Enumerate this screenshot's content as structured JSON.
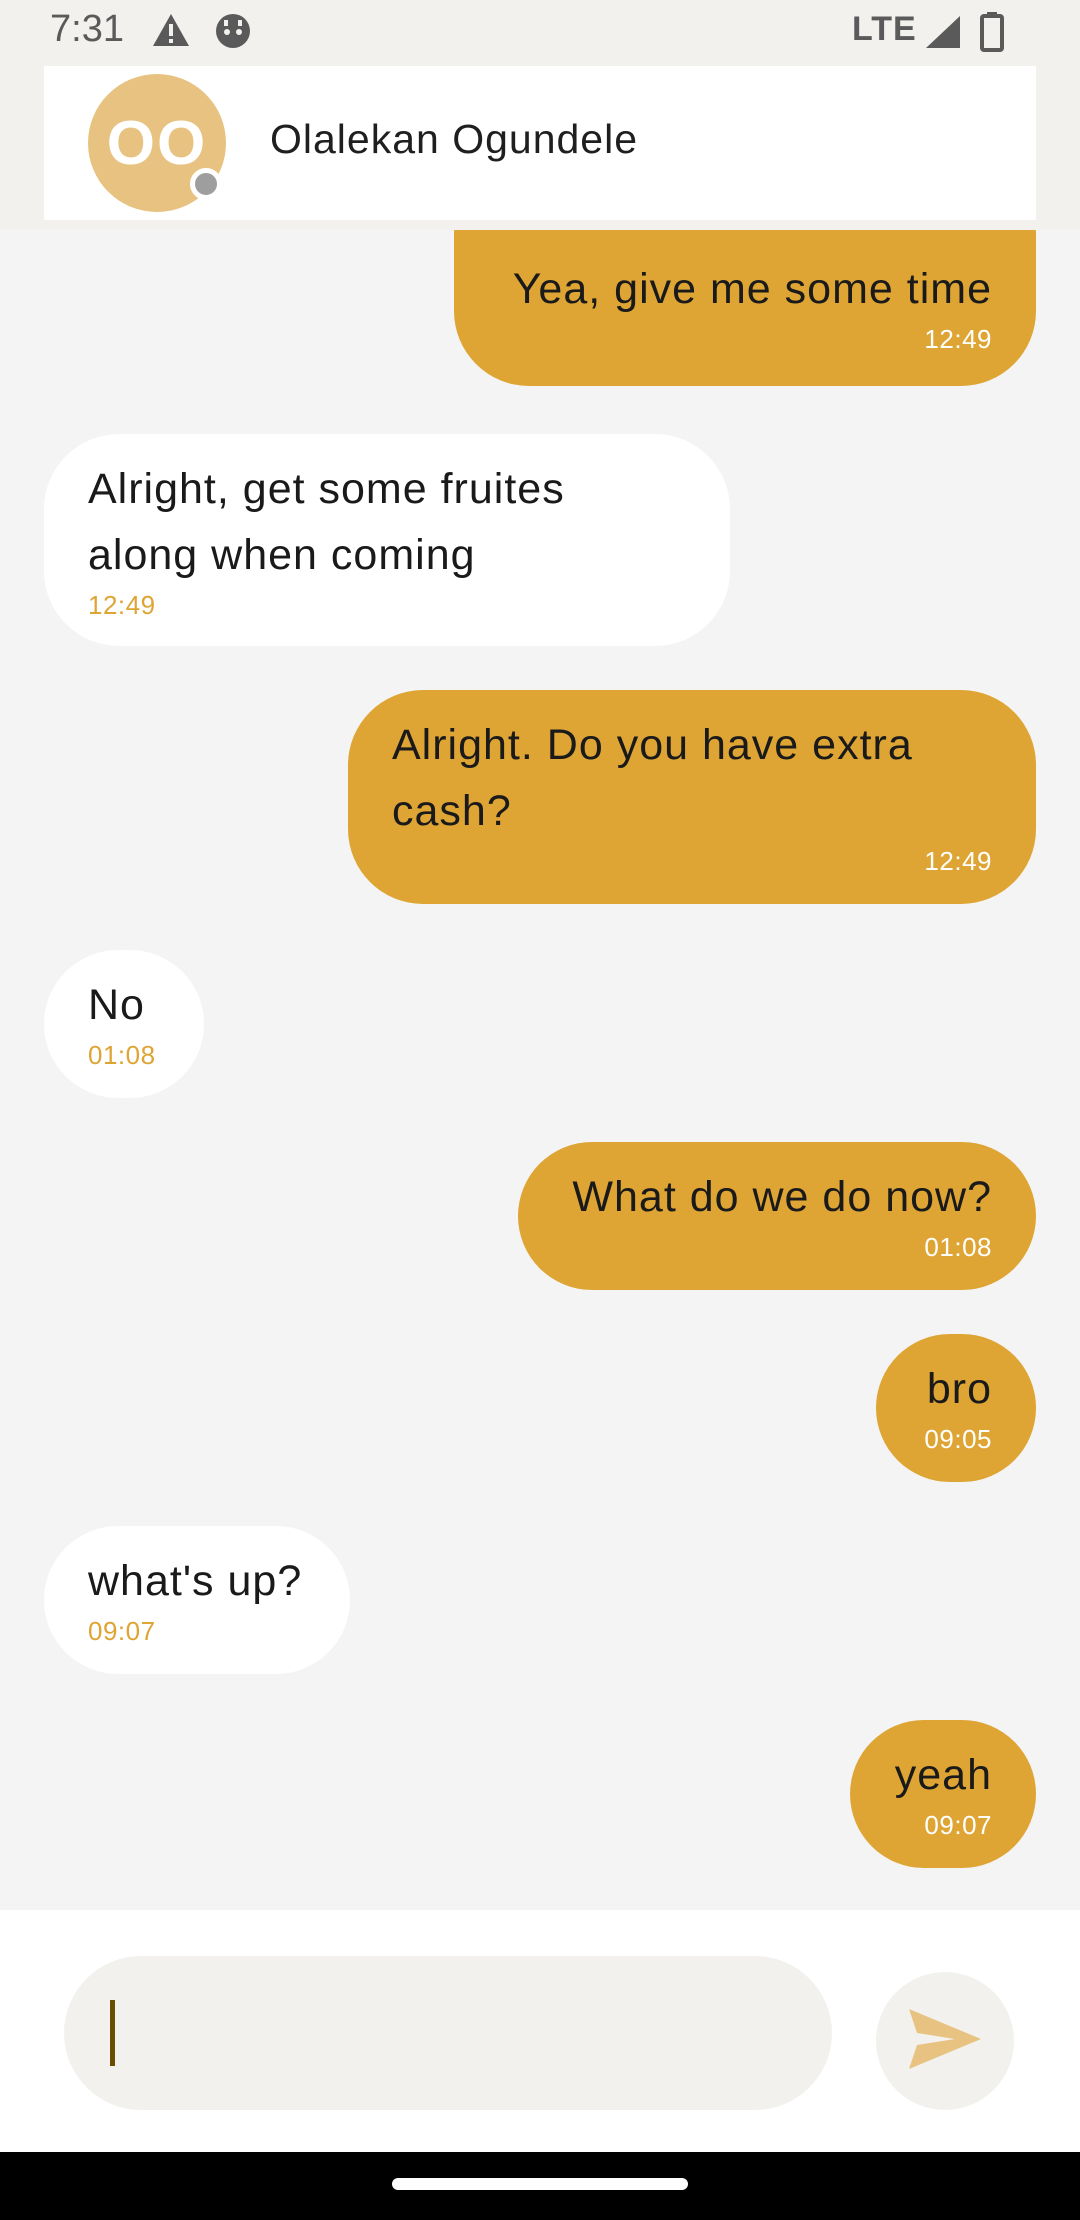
{
  "status_bar": {
    "time": "7:31",
    "network": "LTE",
    "icons": [
      "warning-icon",
      "android-debug-icon",
      "signal-icon",
      "battery-icon"
    ]
  },
  "header": {
    "avatar_initials": "OO",
    "contact_name": "Olalekan Ogundele",
    "presence": "offline"
  },
  "messages": [
    {
      "direction": "out",
      "text": "Yea, give me some time",
      "time": "12:49"
    },
    {
      "direction": "in",
      "text": "Alright, get some fruites along when coming",
      "time": "12:49"
    },
    {
      "direction": "out",
      "text": "Alright. Do you have extra cash?",
      "time": "12:49"
    },
    {
      "direction": "in",
      "text": "No",
      "time": "01:08"
    },
    {
      "direction": "out",
      "text": "What do we do now?",
      "time": "01:08"
    },
    {
      "direction": "out",
      "text": "bro",
      "time": "09:05"
    },
    {
      "direction": "in",
      "text": "what's up?",
      "time": "09:07"
    },
    {
      "direction": "out",
      "text": "yeah",
      "time": "09:07"
    }
  ],
  "composer": {
    "value": "",
    "placeholder": ""
  },
  "colors": {
    "accent": "#dea534",
    "avatar": "#e8c281",
    "send_icon": "#e8c281",
    "background": "#f4f4f4"
  }
}
